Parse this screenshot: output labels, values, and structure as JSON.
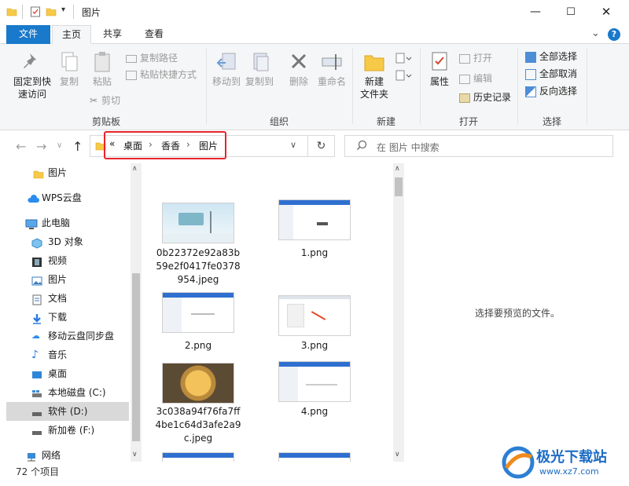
{
  "titlebar": {
    "title": "图片",
    "dropdown_glyph": "▾",
    "minimize_glyph": "—",
    "maximize_glyph": "☐",
    "close_glyph": "✕"
  },
  "tabs": {
    "file": "文件",
    "home": "主页",
    "share": "共享",
    "view": "查看",
    "collapse_glyph": "⌄",
    "help_glyph": "?"
  },
  "ribbon": {
    "pin_line1": "固定到快",
    "pin_line2": "速访问",
    "copy": "复制",
    "paste": "粘贴",
    "copy_path": "复制路径",
    "paste_shortcut": "粘贴快捷方式",
    "cut": "剪切",
    "group_clipboard": "剪贴板",
    "move_to": "移动到",
    "copy_to": "复制到",
    "delete": "删除",
    "rename": "重命名",
    "group_organize": "组织",
    "new_folder_line1": "新建",
    "new_folder_line2": "文件夹",
    "group_new": "新建",
    "properties": "属性",
    "open": "打开",
    "edit": "编辑",
    "history": "历史记录",
    "group_open": "打开",
    "select_all": "全部选择",
    "select_none": "全部取消",
    "invert_selection": "反向选择",
    "group_select": "选择"
  },
  "address": {
    "back_glyph": "←",
    "forward_glyph": "→",
    "recent_glyph": "∨",
    "up_glyph": "↑",
    "overflow_glyph": "«",
    "crumbs": [
      "桌面",
      "香香",
      "图片"
    ],
    "sep_glyph": "›",
    "dropdown_glyph": "∨",
    "refresh_glyph": "↻",
    "search_placeholder": "在 图片 中搜索"
  },
  "nav": {
    "items": [
      {
        "label": "图片",
        "icon": "folder-icon"
      },
      {
        "label": "WPS云盘",
        "icon": "cloud-icon"
      },
      {
        "label": "此电脑",
        "icon": "computer-icon"
      },
      {
        "label": "3D 对象",
        "icon": "cube-icon"
      },
      {
        "label": "视频",
        "icon": "film-icon"
      },
      {
        "label": "图片",
        "icon": "picture-icon"
      },
      {
        "label": "文档",
        "icon": "document-icon"
      },
      {
        "label": "下载",
        "icon": "download-icon"
      },
      {
        "label": "移动云盘同步盘",
        "icon": "cloud-sync-icon"
      },
      {
        "label": "音乐",
        "icon": "music-icon"
      },
      {
        "label": "桌面",
        "icon": "desktop-icon"
      },
      {
        "label": "本地磁盘 (C:)",
        "icon": "drive-icon"
      },
      {
        "label": "软件 (D:)",
        "icon": "drive-icon"
      },
      {
        "label": "新加卷 (F:)",
        "icon": "drive-icon"
      },
      {
        "label": "网络",
        "icon": "network-icon"
      }
    ],
    "scroll_up_glyph": "∧",
    "scroll_down_glyph": "∨"
  },
  "files": [
    {
      "name": "0b22372e92a83b59e2f0417fe0378954.jpeg",
      "kind": "winter"
    },
    {
      "name": "1.png",
      "kind": "screenshot"
    },
    {
      "name": "2.png",
      "kind": "screenshot"
    },
    {
      "name": "3.png",
      "kind": "screenshot"
    },
    {
      "name": "3c038a94f76fa7ff4be1c64d3afe2a9c.jpeg",
      "kind": "flower"
    },
    {
      "name": "4.png",
      "kind": "screenshot"
    }
  ],
  "preview_text": "选择要预览的文件。",
  "status": {
    "item_count": "72 个项目"
  },
  "watermark": {
    "brand": "极光下载站",
    "url": "www.xz7.com"
  },
  "colors": {
    "accent": "#1979ca",
    "highlight_box": "#e8242a",
    "selected_bg": "#d9d9d9"
  }
}
